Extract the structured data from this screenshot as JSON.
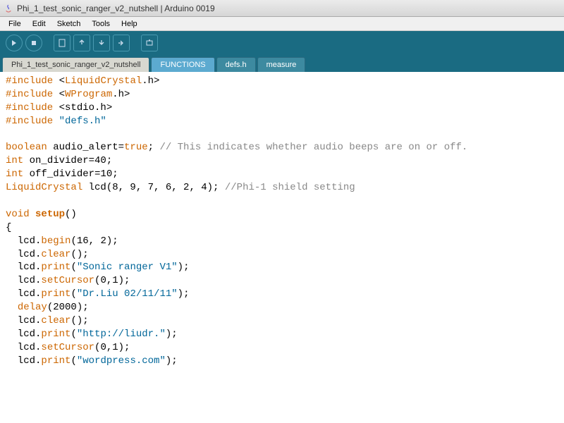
{
  "window": {
    "title": "Phi_1_test_sonic_ranger_v2_nutshell | Arduino 0019"
  },
  "menu": {
    "file": "File",
    "edit": "Edit",
    "sketch": "Sketch",
    "tools": "Tools",
    "help": "Help"
  },
  "tabs": {
    "main": "Phi_1_test_sonic_ranger_v2_nutshell",
    "functions": "FUNCTIONS",
    "defs": "defs.h",
    "measure": "measure"
  },
  "code": {
    "l1a": "#include",
    "l1b": " <",
    "l1c": "LiquidCrystal",
    "l1d": ".h>",
    "l2a": "#include",
    "l2b": " <",
    "l2c": "WProgram",
    "l2d": ".h>",
    "l3a": "#include",
    "l3b": " <stdio.h>",
    "l4a": "#include",
    "l4b": " ",
    "l4c": "\"defs.h\"",
    "l5": "",
    "l6a": "boolean",
    "l6b": " audio_alert=",
    "l6c": "true",
    "l6d": "; ",
    "l6e": "// This indicates whether audio beeps are on or off.",
    "l7a": "int",
    "l7b": " on_divider=40;",
    "l8a": "int",
    "l8b": " off_divider=10;",
    "l9a": "LiquidCrystal",
    "l9b": " lcd(8, 9, 7, 6, 2, 4); ",
    "l9c": "//Phi-1 shield setting",
    "l10": "",
    "l11a": "void",
    "l11b": " ",
    "l11c": "setup",
    "l11d": "()",
    "l12": "{",
    "l13a": "  lcd.",
    "l13b": "begin",
    "l13c": "(16, 2);",
    "l14a": "  lcd.",
    "l14b": "clear",
    "l14c": "();",
    "l15a": "  lcd.",
    "l15b": "print",
    "l15c": "(",
    "l15d": "\"Sonic ranger V1\"",
    "l15e": ");",
    "l16a": "  lcd.",
    "l16b": "setCursor",
    "l16c": "(0,1);",
    "l17a": "  lcd.",
    "l17b": "print",
    "l17c": "(",
    "l17d": "\"Dr.Liu 02/11/11\"",
    "l17e": ");",
    "l18a": "  ",
    "l18b": "delay",
    "l18c": "(2000);",
    "l19a": "  lcd.",
    "l19b": "clear",
    "l19c": "();",
    "l20a": "  lcd.",
    "l20b": "print",
    "l20c": "(",
    "l20d": "\"http://liudr.\"",
    "l20e": ");",
    "l21a": "  lcd.",
    "l21b": "setCursor",
    "l21c": "(0,1);",
    "l22a": "  lcd.",
    "l22b": "print",
    "l22c": "(",
    "l22d": "\"wordpress.com\"",
    "l22e": ");"
  }
}
